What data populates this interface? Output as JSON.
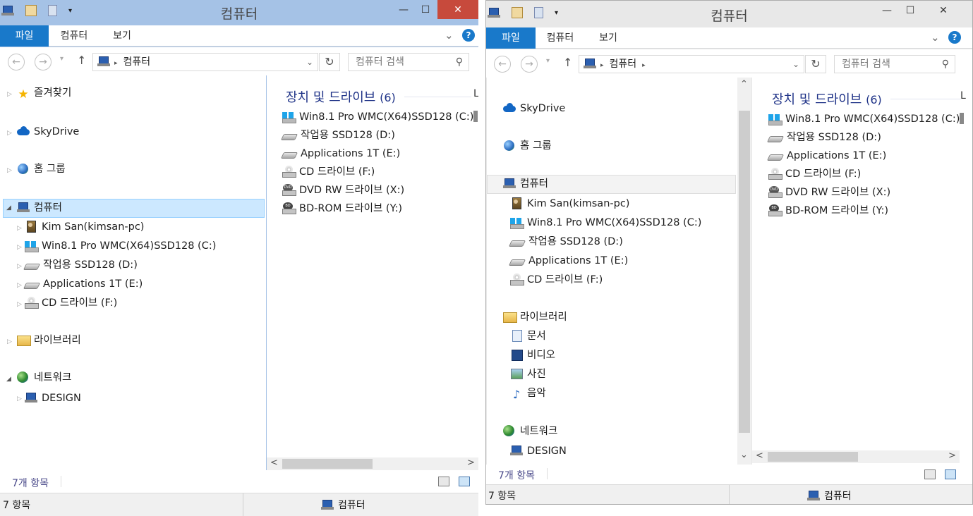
{
  "left": {
    "title": "컴퓨터",
    "tabs": {
      "file": "파일",
      "computer": "컴퓨터",
      "view": "보기"
    },
    "address": {
      "crumb": "컴퓨터",
      "search_placeholder": "컴퓨터 검색"
    },
    "nav": {
      "favorites": "즐겨찾기",
      "skydrive": "SkyDrive",
      "homegroup": "홈 그룹",
      "computer": "컴퓨터",
      "pc_user": "Kim San(kimsan-pc)",
      "drive_c": "Win8.1 Pro WMC(X64)SSD128 (C:)",
      "drive_d": "작업용 SSD128 (D:)",
      "drive_e": "Applications 1T (E:)",
      "drive_f": "CD 드라이브 (F:)",
      "libraries": "라이브러리",
      "network": "네트워크",
      "design": "DESIGN"
    },
    "content": {
      "group_label": "장치 및 드라이브",
      "group_count": "(6)",
      "cut_letter": "L",
      "drives": [
        "Win8.1 Pro WMC(X64)SSD128 (C:)",
        "작업용 SSD128 (D:)",
        "Applications 1T (E:)",
        "CD 드라이브 (F:)",
        "DVD RW 드라이브 (X:)",
        "BD-ROM 드라이브 (Y:)"
      ]
    },
    "status": {
      "items": "7개 항목",
      "bar_items": "7 항목",
      "bar_location": "컴퓨터"
    }
  },
  "right": {
    "title": "컴퓨터",
    "tabs": {
      "file": "파일",
      "computer": "컴퓨터",
      "view": "보기"
    },
    "address": {
      "crumb": "컴퓨터",
      "search_placeholder": "컴퓨터 검색"
    },
    "nav": {
      "skydrive": "SkyDrive",
      "homegroup": "홈 그룹",
      "computer": "컴퓨터",
      "pc_user": "Kim San(kimsan-pc)",
      "drive_c": "Win8.1 Pro WMC(X64)SSD128 (C:)",
      "drive_d": "작업용 SSD128 (D:)",
      "drive_e": "Applications 1T (E:)",
      "drive_f": "CD 드라이브 (F:)",
      "libraries": "라이브러리",
      "documents": "문서",
      "videos": "비디오",
      "pictures": "사진",
      "music": "음악",
      "network": "네트워크",
      "design": "DESIGN"
    },
    "content": {
      "group_label": "장치 및 드라이브",
      "group_count": "(6)",
      "cut_letter": "L",
      "drives": [
        "Win8.1 Pro WMC(X64)SSD128 (C:)",
        "작업용 SSD128 (D:)",
        "Applications 1T (E:)",
        "CD 드라이브 (F:)",
        "DVD RW 드라이브 (X:)",
        "BD-ROM 드라이브 (Y:)"
      ]
    },
    "status": {
      "items": "7개 항목",
      "bar_items": "7 항목",
      "bar_location": "컴퓨터"
    }
  },
  "glyphs": {
    "minimize": "—",
    "maximize": "☐",
    "close": "✕",
    "back": "←",
    "forward": "→",
    "up": "↑",
    "dropdown": "▾",
    "chevron": "⌄",
    "help": "?",
    "refresh": "↻",
    "search": "⚲",
    "crumb_sep": "▸",
    "scroll_left": "<",
    "scroll_right": ">",
    "scroll_up": "⌃",
    "scroll_down": "⌄",
    "star": "★",
    "note": "♪",
    "expand": "▷",
    "expanded": "◢"
  }
}
